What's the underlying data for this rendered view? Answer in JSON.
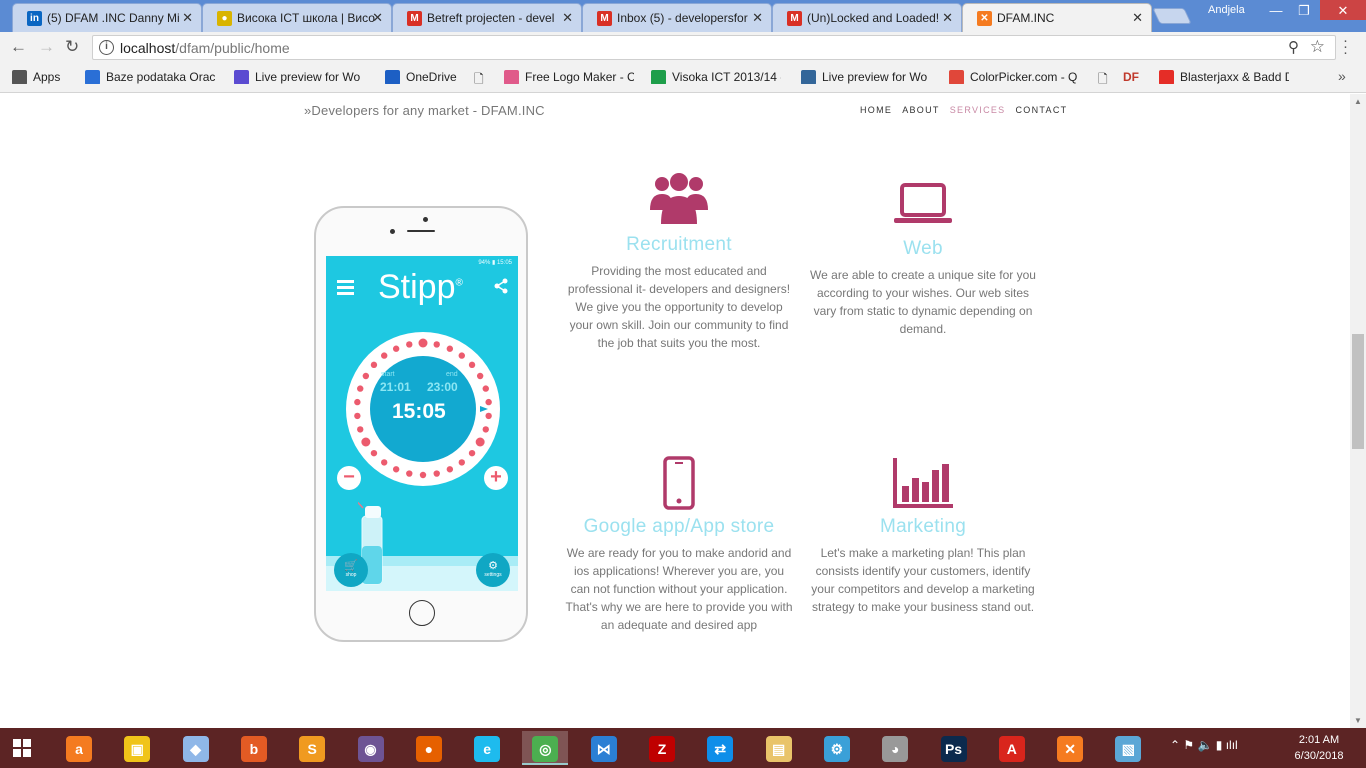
{
  "browser": {
    "tabs": [
      {
        "title": "(5) DFAM .INC Danny Mi",
        "icon": "linkedin-icon",
        "color": "#0a66c2",
        "glyph": "in"
      },
      {
        "title": "Висока ICT школа | Висо",
        "icon": "school-icon",
        "color": "#d9b400",
        "glyph": "●"
      },
      {
        "title": "Betreft projecten - devel",
        "icon": "gmail-icon",
        "color": "#d93025",
        "glyph": "M"
      },
      {
        "title": "Inbox (5) - developersfor",
        "icon": "gmail-icon",
        "color": "#d93025",
        "glyph": "M"
      },
      {
        "title": "(Un)Locked and Loaded!",
        "icon": "gmail-icon",
        "color": "#d93025",
        "glyph": "M"
      },
      {
        "title": "DFAM.INC",
        "icon": "xampp-icon",
        "color": "#f57b20",
        "glyph": "✕"
      }
    ],
    "profile_name": "Andjela",
    "url_host": "localhost",
    "url_path": "/dfam/public/home",
    "bookmarks": [
      {
        "label": "Apps",
        "color": "#555"
      },
      {
        "label": "Baze podataka Oracl",
        "color": "#2a6fd6"
      },
      {
        "label": "Live preview for Wo",
        "color": "#5b4bd1"
      },
      {
        "label": "OneDrive",
        "color": "#1d5fc4"
      },
      {
        "label": "Free Logo Maker - C",
        "color": "#e05a8a"
      },
      {
        "label": "Visoka ICT 2013/14 -",
        "color": "#1e9e4a"
      },
      {
        "label": "Live preview for Wo",
        "color": "#336699"
      },
      {
        "label": "ColorPicker.com - Q",
        "color": "#e0473a"
      },
      {
        "label": "Blasterjaxx & Badd D",
        "color": "#e52d27"
      }
    ],
    "bookmark_df_label": "DF"
  },
  "site": {
    "title": "»Developers for any market - DFAM.INC",
    "nav": [
      {
        "label": "HOME"
      },
      {
        "label": "ABOUT"
      },
      {
        "label": "SERVICES",
        "current": true
      },
      {
        "label": "CONTACT"
      }
    ],
    "accent_color": "#b03a6a",
    "heading_color": "#9be1ef",
    "phone_app": {
      "name": "Stipp",
      "mark": "®",
      "status": "94% ▮ 15:05",
      "start_label": "start",
      "end_label": "end",
      "start_time": "21:01",
      "end_time": "23:00",
      "current_time": "15:05",
      "minus": "−",
      "plus": "+",
      "shop_label": "shop",
      "settings_label": "settings"
    },
    "services": [
      {
        "title": "Recruitment",
        "icon": "users-icon",
        "text": "Providing the most educated and professional it- developers and designers! We give you the opportunity to develop your own skill. Join our community to find the job that suits you the most."
      },
      {
        "title": "Web",
        "icon": "laptop-icon",
        "text": "We are able to create a unique site for you according to your wishes. Our web sites vary from static to dynamic depending on demand."
      },
      {
        "title": "Google app/App store",
        "icon": "mobile-icon",
        "text": "We are ready for you to make andorid and ios applications! Wherever you are, you can not function without your application. That's why we are here to provide you with an adequate and desired app"
      },
      {
        "title": "Marketing",
        "icon": "bar-chart-icon",
        "text": "Let's make a marketing plan! This plan consists identify your customers, identify your competitors and develop a marketing strategy to make your business stand out."
      }
    ]
  },
  "taskbar": {
    "apps": [
      {
        "name": "avast-icon",
        "color": "#f47b20"
      },
      {
        "name": "file-explorer-icon",
        "color": "#f0c419"
      },
      {
        "name": "virtualbox-icon",
        "color": "#8fb7e8"
      },
      {
        "name": "bandicam-icon",
        "color": "#e35b24"
      },
      {
        "name": "sublime-icon",
        "color": "#f09a20"
      },
      {
        "name": "github-icon",
        "color": "#6e5494"
      },
      {
        "name": "firefox-icon",
        "color": "#e66000"
      },
      {
        "name": "ie-icon",
        "color": "#1ebbee"
      },
      {
        "name": "chrome-icon",
        "color": "#4caf50",
        "active": true
      },
      {
        "name": "vscode-icon",
        "color": "#2b7fd4"
      },
      {
        "name": "filezilla-icon",
        "color": "#bf0000"
      },
      {
        "name": "teamviewer-icon",
        "color": "#0e8ee9"
      },
      {
        "name": "folder-icon",
        "color": "#e9c46a"
      },
      {
        "name": "settings-app-icon",
        "color": "#3aa0d8"
      },
      {
        "name": "koala-icon",
        "color": "#999999"
      },
      {
        "name": "photoshop-icon",
        "color": "#0c2a4d"
      },
      {
        "name": "acrobat-icon",
        "color": "#d9251c"
      },
      {
        "name": "xampp-icon",
        "color": "#f57b20"
      },
      {
        "name": "photos-icon",
        "color": "#5ba7d6"
      }
    ],
    "time": "2:01 AM",
    "date": "6/30/2018"
  }
}
